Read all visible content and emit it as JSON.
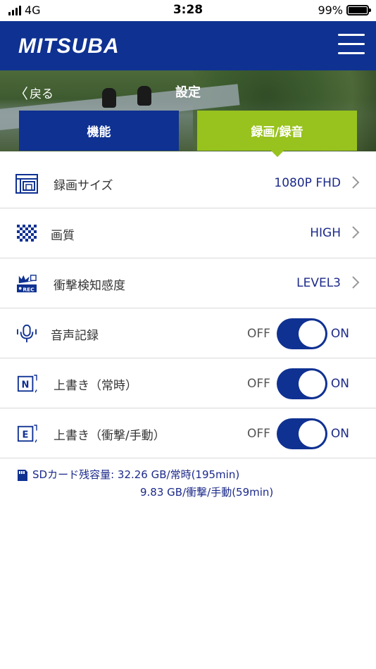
{
  "status_bar": {
    "carrier": "4G",
    "time": "3:28",
    "battery": "99%"
  },
  "header": {
    "logo": "MITSUBA"
  },
  "nav": {
    "back_label": "戻る",
    "title": "設定"
  },
  "tabs": [
    {
      "label": "機能",
      "active": false
    },
    {
      "label": "録画/録音",
      "active": true
    }
  ],
  "settings": {
    "record_size": {
      "label": "録画サイズ",
      "value": "1080P FHD"
    },
    "quality": {
      "label": "画質",
      "value": "HIGH"
    },
    "shock_sensitivity": {
      "label": "衝撃検知感度",
      "value": "LEVEL3"
    },
    "audio_record": {
      "label": "音声記録",
      "off": "OFF",
      "on": "ON",
      "state": "on"
    },
    "overwrite_normal": {
      "label": "上書き（常時）",
      "off": "OFF",
      "on": "ON",
      "state": "on"
    },
    "overwrite_event": {
      "label": "上書き（衝撃/手動）",
      "off": "OFF",
      "on": "ON",
      "state": "on"
    }
  },
  "sd_card": {
    "line1": "SDカード残容量: 32.26 GB/常時(195min)",
    "line2": "9.83 GB/衝撃/手動(59min)"
  },
  "colors": {
    "brand_blue": "#0f3192",
    "accent_green": "#98c21d",
    "text_blue": "#1c2a8a"
  }
}
